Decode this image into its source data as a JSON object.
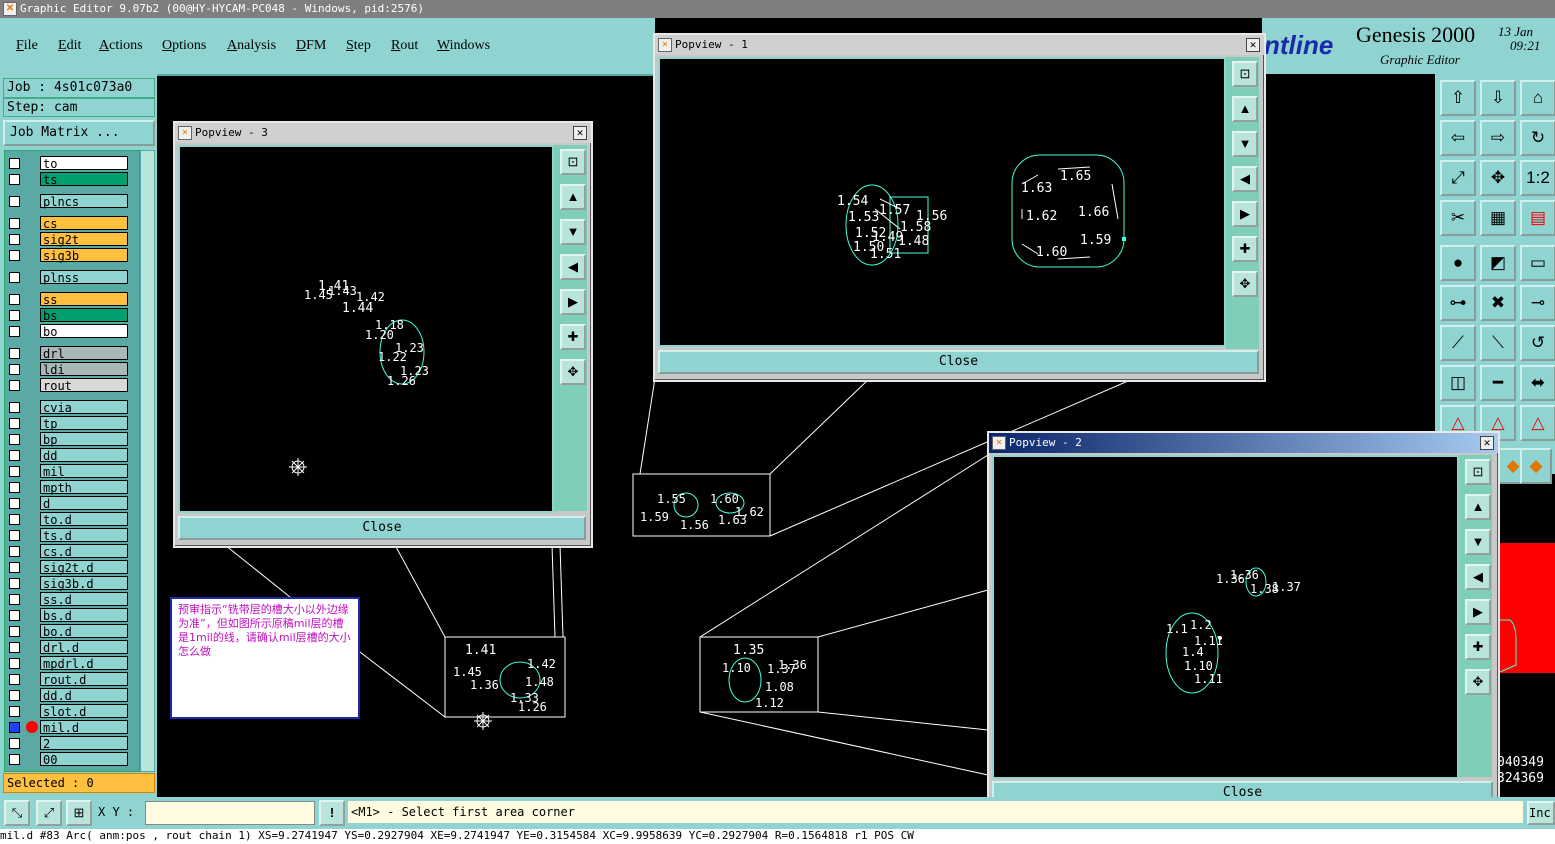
{
  "window": {
    "title": "Graphic Editor 9.07b2 (00@HY-HYCAM-PC048 - Windows, pid:2576)"
  },
  "menu": [
    "File",
    "Edit",
    "Actions",
    "Options",
    "Analysis",
    "DFM",
    "Step",
    "Rout",
    "Windows"
  ],
  "brand": {
    "logo": "ntline",
    "name": "Genesis 2000",
    "sub": "Graphic Editor",
    "date": "13 Jan",
    "time": "09:21"
  },
  "job": {
    "label": "Job : 4s01c073a0",
    "step": "Step: cam",
    "matrix_btn": "Job Matrix ..."
  },
  "layers": [
    {
      "name": "to",
      "color": "#ffffff"
    },
    {
      "name": "ts",
      "color": "#00a070"
    },
    {
      "name": "plncs",
      "color": "#8fd4d0"
    },
    {
      "name": "cs",
      "color": "#ffc040"
    },
    {
      "name": "sig2t",
      "color": "#ffc040"
    },
    {
      "name": "sig3b",
      "color": "#ffc040"
    },
    {
      "name": "plnss",
      "color": "#8fd4d0"
    },
    {
      "name": "ss",
      "color": "#ffc040"
    },
    {
      "name": "bs",
      "color": "#00a070"
    },
    {
      "name": "bo",
      "color": "#ffffff"
    },
    {
      "name": "drl",
      "color": "#a8b8b8"
    },
    {
      "name": "ldi",
      "color": "#a8b8b8"
    },
    {
      "name": "rout",
      "color": "#d8d8d8"
    },
    {
      "name": "cvia",
      "color": "#8fd4d0"
    },
    {
      "name": "tp",
      "color": "#8fd4d0"
    },
    {
      "name": "bp",
      "color": "#8fd4d0"
    },
    {
      "name": "dd",
      "color": "#8fd4d0"
    },
    {
      "name": "mil",
      "color": "#8fd4d0"
    },
    {
      "name": "mpth",
      "color": "#8fd4d0"
    },
    {
      "name": "d",
      "color": "#8fd4d0"
    },
    {
      "name": "to.d",
      "color": "#8fd4d0"
    },
    {
      "name": "ts.d",
      "color": "#8fd4d0"
    },
    {
      "name": "cs.d",
      "color": "#8fd4d0"
    },
    {
      "name": "sig2t.d",
      "color": "#8fd4d0"
    },
    {
      "name": "sig3b.d",
      "color": "#8fd4d0"
    },
    {
      "name": "ss.d",
      "color": "#8fd4d0"
    },
    {
      "name": "bs.d",
      "color": "#8fd4d0"
    },
    {
      "name": "bo.d",
      "color": "#8fd4d0"
    },
    {
      "name": "drl.d",
      "color": "#8fd4d0"
    },
    {
      "name": "mpdrl.d",
      "color": "#8fd4d0"
    },
    {
      "name": "rout.d",
      "color": "#8fd4d0"
    },
    {
      "name": "dd.d",
      "color": "#8fd4d0"
    },
    {
      "name": "slot.d",
      "color": "#8fd4d0"
    },
    {
      "name": "mil.d",
      "color": "#8fd4d0",
      "active": true
    },
    {
      "name": "2",
      "color": "#8fd4d0"
    },
    {
      "name": "00",
      "color": "#8fd4d0"
    }
  ],
  "selected": "Selected : 0",
  "note": "预审指示“铣带层的槽大小以外边缘为准”，但如图所示原稿mil层的槽是1mil的线，请确认mil层槽的大小怎么做",
  "popups": {
    "p1": {
      "title": "Popview - 1",
      "close": "Close"
    },
    "p2": {
      "title": "Popview - 2",
      "close": "Close"
    },
    "p3": {
      "title": "Popview - 3",
      "close": "Close"
    }
  },
  "status": {
    "xy_label": "X Y :",
    "xy_value": "",
    "prompt": "<M1> - Select first area corner",
    "right_btn": "Inc",
    "coord1": "040349",
    "coord2": "324369"
  },
  "cmdline": "mil.d #83 Arc(  anm:pos  , rout chain 1) XS=9.2741947 YS=0.2927904 XE=9.2741947 YE=0.3154584 XC=9.9958639 YC=0.2927904 R=0.1564818 r1 POS CW",
  "measures": {
    "p1_left": [
      "1.54",
      "1.57",
      "1.56",
      "1.53",
      "1.58",
      "1.52",
      "1.49",
      "1.48",
      "1.50",
      "1.51"
    ],
    "p1_right": [
      "1.65",
      "1.63",
      "1.66",
      "1.62",
      "1.59",
      "1.60"
    ],
    "p2": [
      "1.36",
      "1.37",
      "1.38",
      "1.36",
      "1.1",
      "1.2",
      "1.4",
      "1.11",
      "1.10",
      "1.11"
    ],
    "p3_top": [
      "1.41",
      "1.45",
      "1.42",
      "1.44",
      "1.43"
    ],
    "p3_slot": [
      "1.18",
      "1.20",
      "1.23",
      "1.22",
      "1.23",
      "1.26"
    ],
    "box_a": [
      "1.41",
      "1.42",
      "1.45",
      "1.48",
      "1.36",
      "1.33",
      "1.26"
    ],
    "box_b": [
      "1.35",
      "1.36",
      "1.37",
      "1.10",
      "1.08",
      "1.12"
    ],
    "box_c": [
      "1.55",
      "1.60",
      "1.62",
      "1.63",
      "1.56",
      "1.59"
    ]
  }
}
